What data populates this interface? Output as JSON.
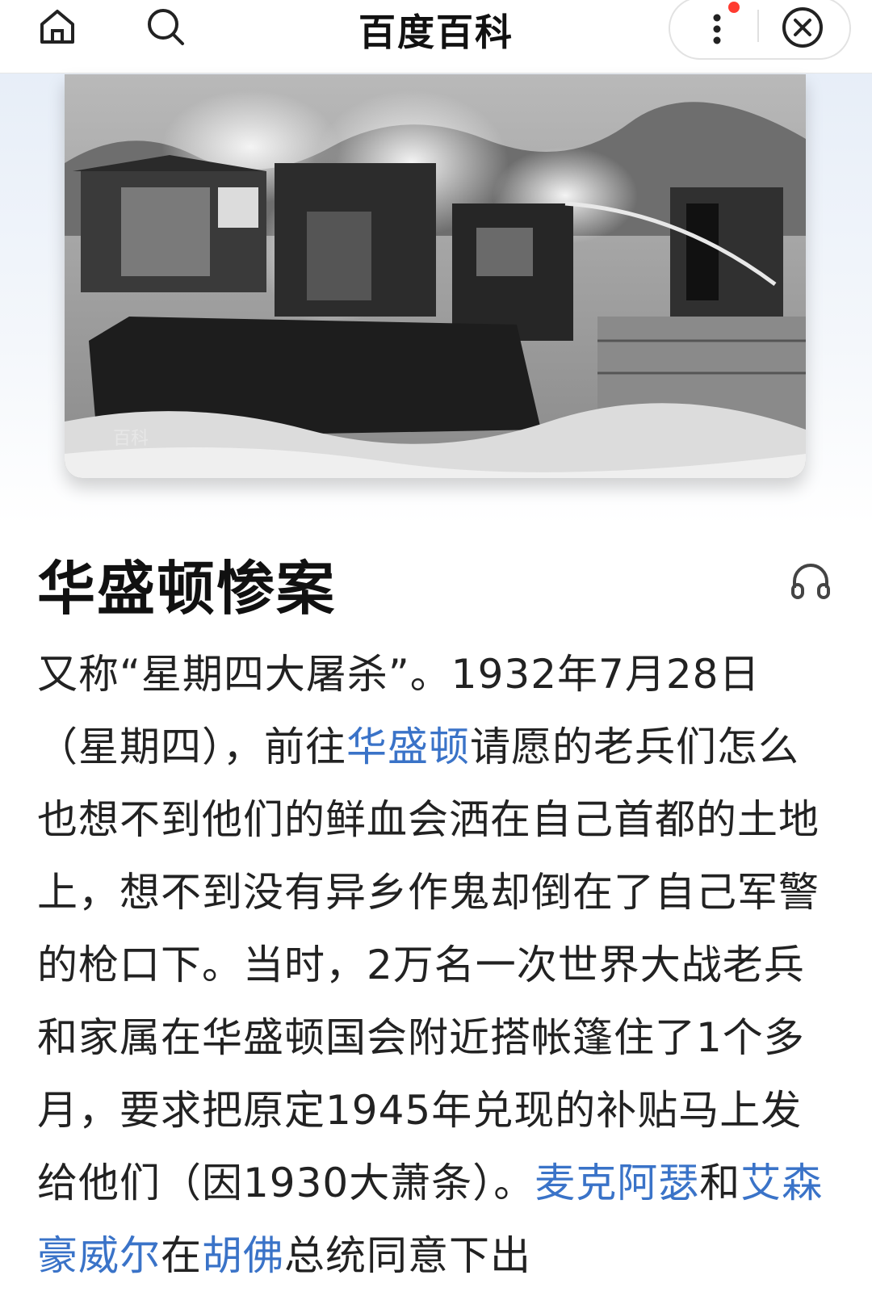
{
  "header": {
    "title": "百度百科",
    "home_icon": "home-icon",
    "search_icon": "search-icon",
    "more_icon": "more-vertical-icon",
    "close_icon": "close-icon"
  },
  "entry": {
    "title": "华盛顿惨案",
    "audio_icon": "headphones-icon"
  },
  "image": {
    "watermark": "百科"
  },
  "article": {
    "s1": "又称“星期四大屠杀”。1932年7月28日（星期四），前往",
    "l1": "华盛顿",
    "s2": "请愿的老兵们怎么也想不到他们的鲜血会洒在自己首都的土地上，想不到没有异乡作鬼却倒在了自己军警的枪口下。当时，2万名一次世界大战老兵和家属在华盛顿国会附近搭帐篷住了1个多月，要求把原定1945年兑现的补贴马上发给他们（因1930大萧条）。",
    "l2": "麦克阿瑟",
    "s3": "和",
    "l3": "艾森豪威尔",
    "s4": "在",
    "l4": "胡佛",
    "s5": "总统同意下出"
  },
  "colors": {
    "link": "#3a73c8",
    "accent_dot": "#ff3b30"
  }
}
